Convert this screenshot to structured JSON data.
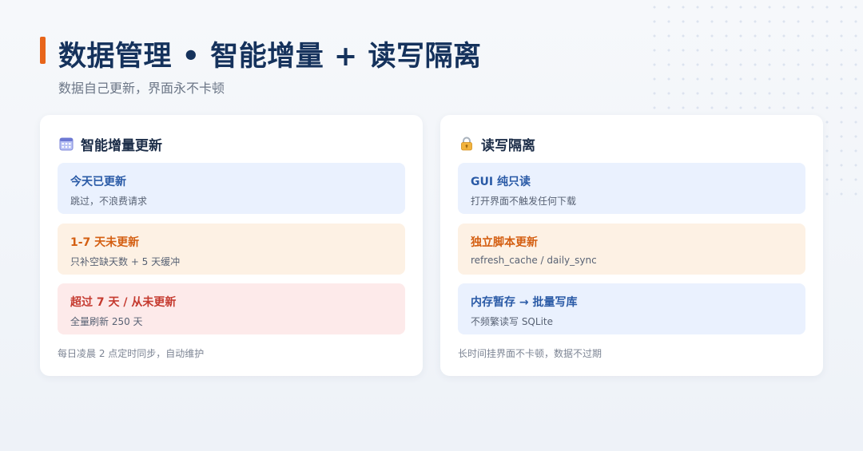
{
  "header": {
    "title": "数据管理 • 智能增量 + 读写隔离",
    "subtitle": "数据自己更新，界面永不卡顿"
  },
  "left_card": {
    "icon": "calendar-icon",
    "title": "智能增量更新",
    "items": [
      {
        "title": "今天已更新",
        "desc": "跳过，不浪费请求"
      },
      {
        "title": "1-7 天未更新",
        "desc": "只补空缺天数 + 5 天缓冲"
      },
      {
        "title": "超过 7 天 / 从未更新",
        "desc": "全量刷新 250 天"
      }
    ],
    "footer": "每日凌晨 2 点定时同步，自动维护"
  },
  "right_card": {
    "icon": "lock-icon",
    "title": "读写隔离",
    "items": [
      {
        "title": "GUI 纯只读",
        "desc": "打开界面不触发任何下载"
      },
      {
        "title": "独立脚本更新",
        "desc": "refresh_cache / daily_sync"
      },
      {
        "title": "内存暂存 → 批量写库",
        "desc": "不频繁读写 SQLite"
      }
    ],
    "footer": "长时间挂界面不卡顿，数据不过期"
  },
  "colors": {
    "accent": "#e8651a",
    "title": "#15325c",
    "blue_bg": "#eaf1fe",
    "blue_text": "#2a5aa6",
    "orange_bg": "#fdf1e4",
    "orange_text": "#d45f12",
    "red_bg": "#fdeaea",
    "red_text": "#c53a2f"
  }
}
